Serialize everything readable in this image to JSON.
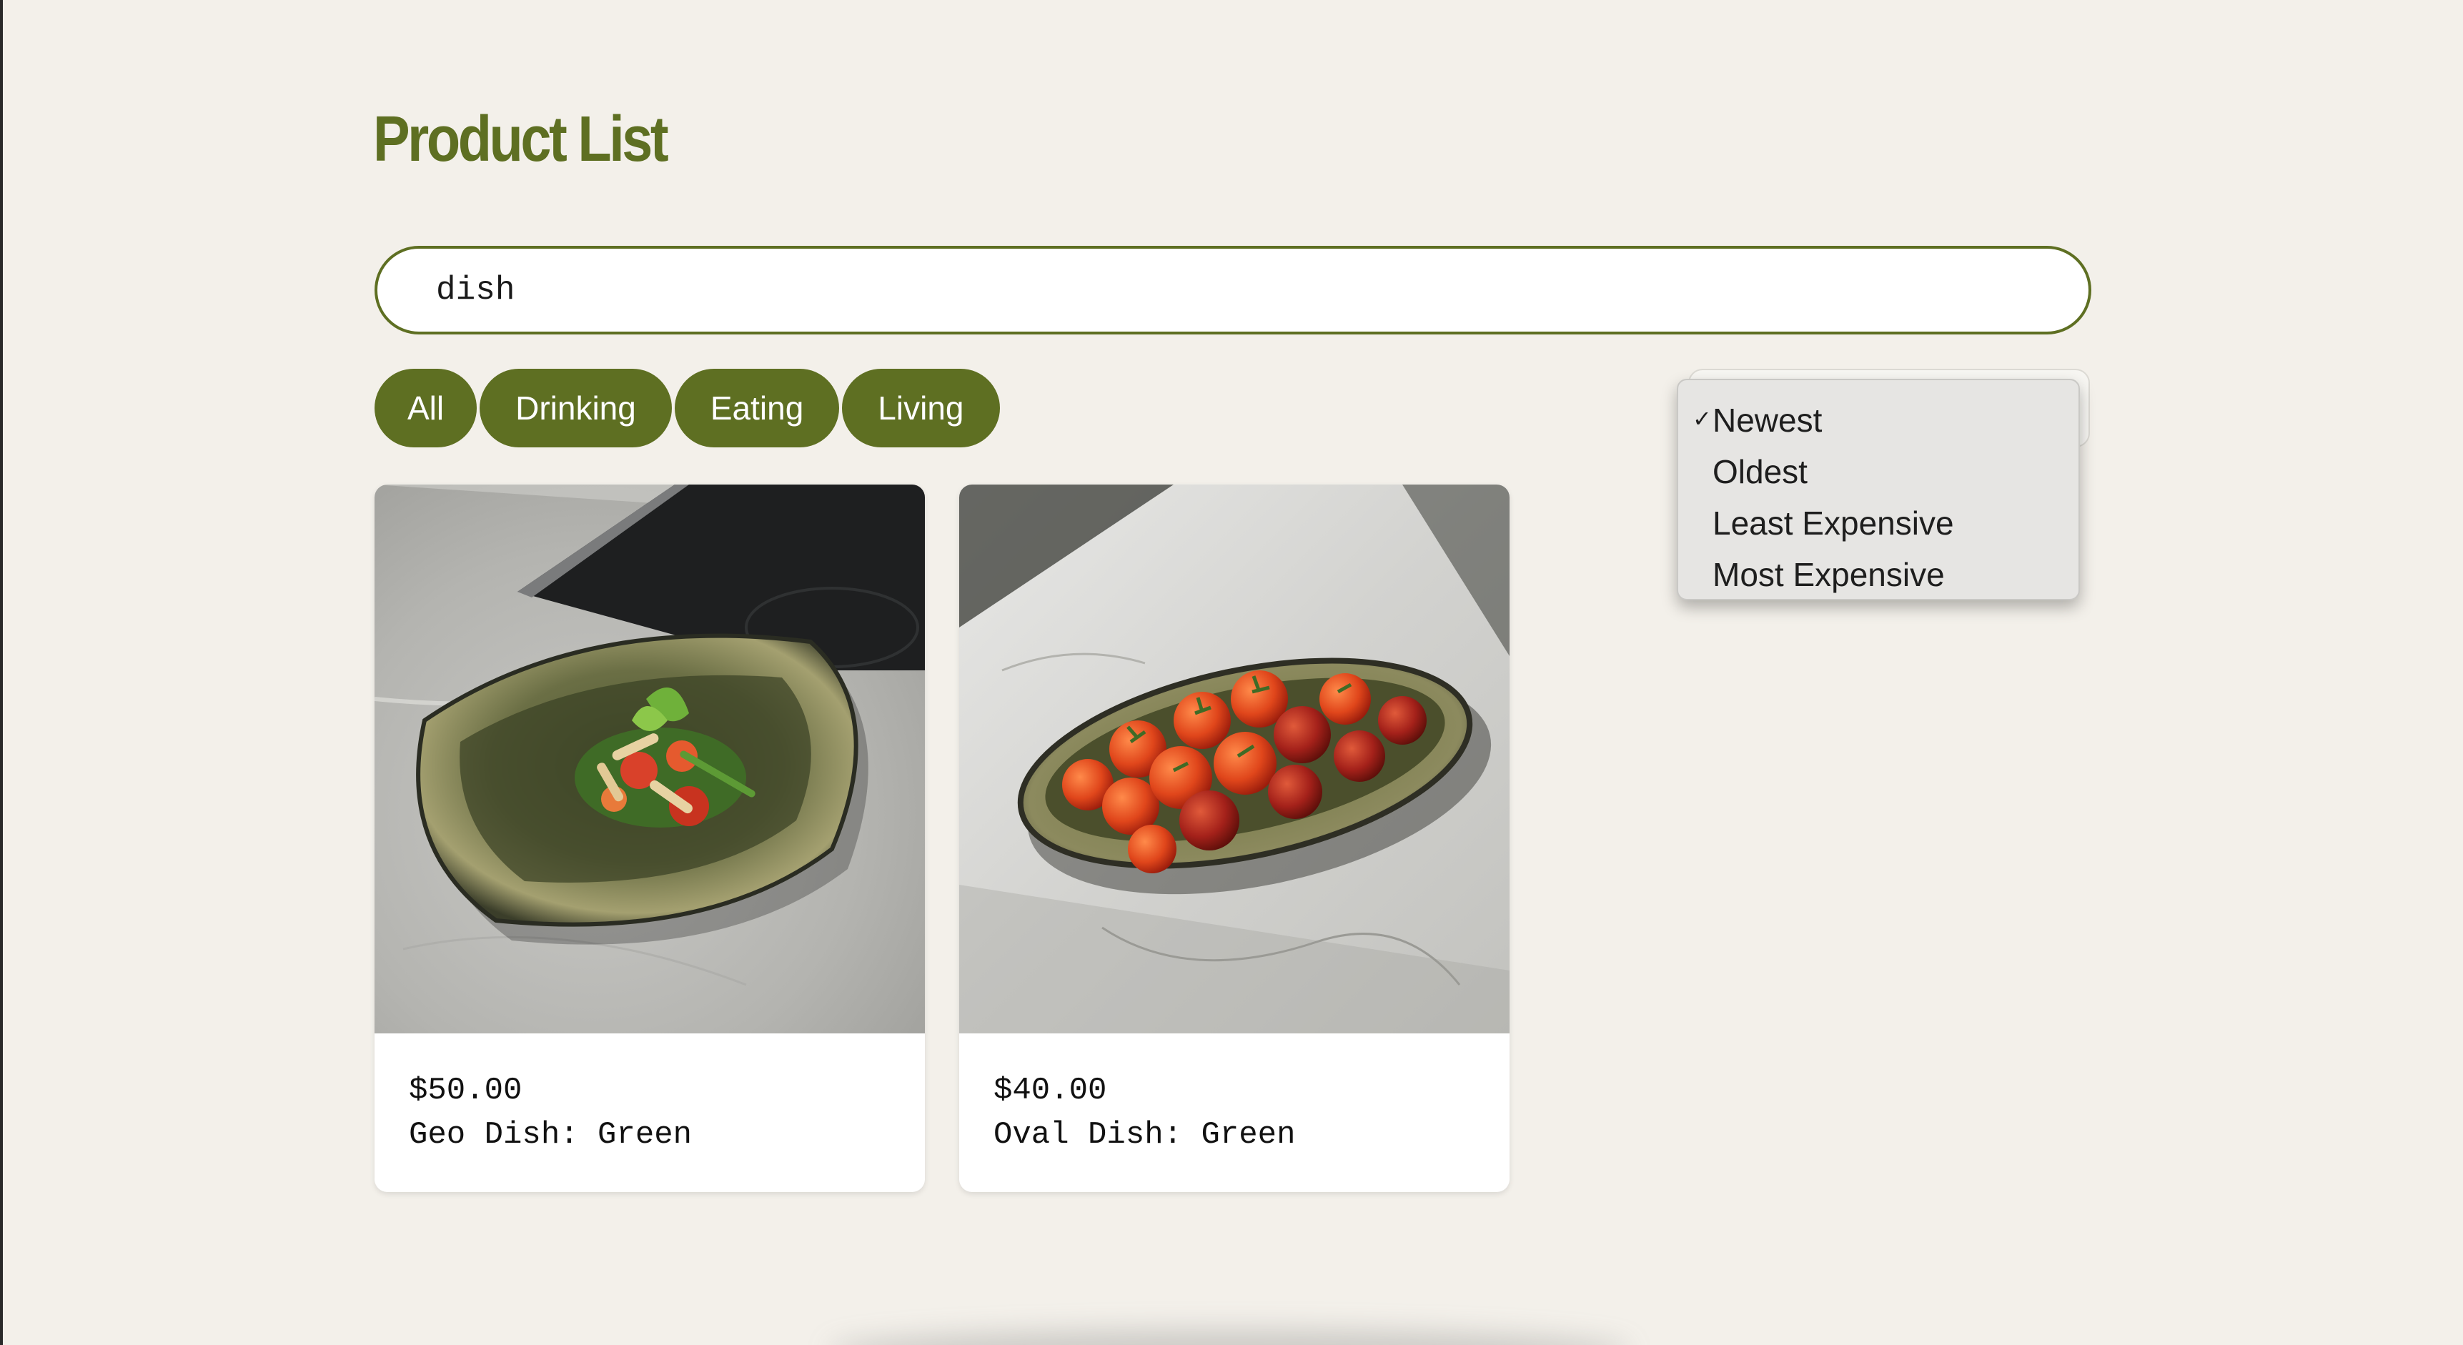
{
  "page": {
    "title": "Product List"
  },
  "search": {
    "value": "dish"
  },
  "filters": [
    {
      "label": "All"
    },
    {
      "label": "Drinking"
    },
    {
      "label": "Eating"
    },
    {
      "label": "Living"
    }
  ],
  "sort": {
    "selected": "Newest",
    "options": [
      {
        "label": "Newest",
        "checked": true
      },
      {
        "label": "Oldest",
        "checked": false
      },
      {
        "label": "Least Expensive",
        "checked": false
      },
      {
        "label": "Most Expensive",
        "checked": false
      }
    ],
    "check_glyph": "✓"
  },
  "products": [
    {
      "price": "$50.00",
      "name": "Geo Dish: Green",
      "image": "green geo dish with pasta salad"
    },
    {
      "price": "$40.00",
      "name": "Oval Dish: Green",
      "image": "green oval dish with cherry tomatoes"
    }
  ],
  "colors": {
    "accent": "#5e6f22",
    "background": "#f3f0ea",
    "card": "#ffffff"
  }
}
